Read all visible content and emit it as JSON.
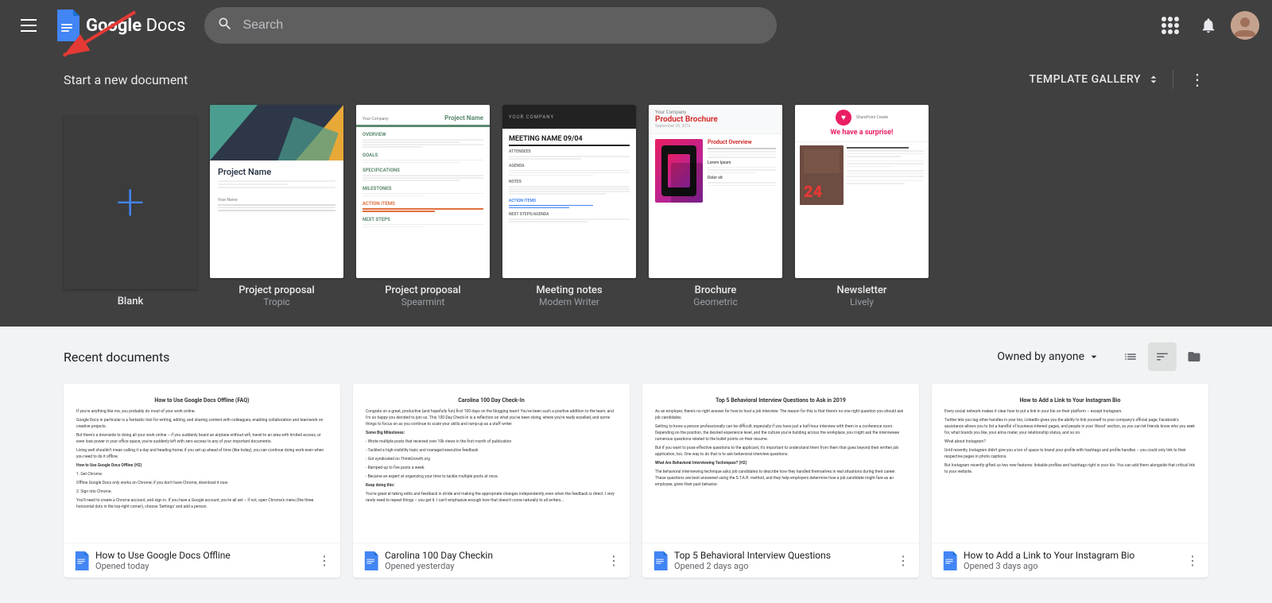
{
  "header": {
    "menu_label": "Main menu",
    "logo_text": "Google Docs",
    "logo_google": "Google",
    "logo_docs": "Docs",
    "search_placeholder": "Search",
    "apps_label": "Google apps",
    "notifications_label": "Notifications"
  },
  "template_section": {
    "title": "Start a new document",
    "gallery_label": "TEMPLATE GALLERY",
    "templates": [
      {
        "id": "blank",
        "name": "Blank",
        "sub": ""
      },
      {
        "id": "project-tropic",
        "name": "Project proposal",
        "sub": "Tropic"
      },
      {
        "id": "project-spearmint",
        "name": "Project proposal",
        "sub": "Spearmint"
      },
      {
        "id": "meeting-notes",
        "name": "Meeting notes",
        "sub": "Modern Writer"
      },
      {
        "id": "brochure",
        "name": "Brochure",
        "sub": "Geometric"
      },
      {
        "id": "newsletter",
        "name": "Newsletter",
        "sub": "Lively"
      }
    ]
  },
  "recent_section": {
    "title": "Recent documents",
    "owned_by_label": "Owned by anyone",
    "docs": [
      {
        "name": "How to Use Google Docs Offline",
        "date": "Opened today",
        "preview_title": "How to Use Google Docs Offline (FAQ)",
        "preview_lines": [
          "If you're anything like me, you probably do most of your work online.",
          "Google Docs in particular is a fantastic tool for writing, editing, and sharing content with colleagues, enabling collaboration and teamwork on creative projects.",
          "But there's a downside to doing all your work online – if you suddenly board an airplane without wifi, travel to an area with limited access, or even lose power in your office space, you're suddenly left with zero access to any of your important documents.",
          "Living well shouldn't mean calling it a day and heading home; if you set up ahead of time (like today), you can continue doing work even when you need to do it offline.",
          "How to Use Google Docs Offline (H2)",
          "1. Get Chrome.",
          "Offline Google Docs only works on Chrome; if you don't have Chrome, download it now.",
          "2. Sign into Chrome.",
          "You'll need to create a Chrome account, and sign in. If you have a Google account, you're all set – if not, open Chrome's menu (the three horizontal dots in the top-right corner), choose 'Settings' and add a person."
        ]
      },
      {
        "name": "Carolina 100 Day Checkin",
        "date": "Opened yesterday",
        "preview_title": "Carolina 100 Day Check-In",
        "preview_lines": [
          "Congrats on a great, productive (and hopefully fun) first 100 days on the blogging team! You've been such a positive addition to the team, and I'm so happy you decided to join us. This 100-Day Check-In is a reflection on what you've been doing, where you're really excelled, and some things to focus on as you continue to scale your skills and ramp-up as a staff writer.",
          "Some Big Milestones:",
          "Wrote multiple posts that received over 10k views in the first month of publication",
          "Tackled a high-visibility topic and managed executive feedback",
          "Got syndicated on ThinkGrowth.org",
          "Ramped-up to five posts a week",
          "Became an expert at organizing your time to tackle multiple posts at once.",
          "Keep doing this:",
          "You're great at taking edits and feedback in stride and making the appropriate changes independently, even when the feedback is direct. I very rarely need to repeat things..."
        ]
      },
      {
        "name": "Top 5 Behavioral Interview Questions",
        "date": "Opened 2 days ago",
        "preview_title": "Top 5 Behavioral Interview Questions to Ask in 2019",
        "preview_lines": [
          "As an employer, there's no right answer for how to host a job interview. The reason for this is that there's no one right question you should ask job candidates.",
          "Getting to know a person professionally can be difficult, especially if you have just a half-hour interview with them in a conference room. Depending on the position, the desired experience level, and the culture you're building across the workplace, you might ask the interviewee numerous questions related to the bullet points on their resume.",
          "But if you want to pose effective questions to the applicant, it's important to understand them from them that goes beyond their written job application, too. One way to do that is to ask behavioral interview questions.",
          "What Are Behavioral Interviewing Techniques? (H2)",
          "The behavioral interviewing technique asks job candidates to describe how they handled themselves in real situations during their career. These questions are best answered using the S.T.A.R. method, and they help employers determine how a job candidate might fare as an employee, given their past behavior."
        ]
      },
      {
        "name": "How to Add a Link to Your Instagram Bio",
        "date": "Opened 3 days ago",
        "preview_title": "How to Add a Link to Your Instagram Bio",
        "preview_lines": [
          "Every social network makes it clear how to put a link in your bio on their platform – except Instagram.",
          "Twitter lets you tag other handles in your bio; LinkedIn gives you the ability to link yourself to your company's official page; Facebook's assistance allows you to list a handful of business-interest pages, and people in your 'About' section, so you can let friends know who you seek for, what brands you like, your alma mater, your relationship status, and so on.",
          "What about Instagram?",
          "Until recently, Instagram didn't give you a ton of space to brand your profile with hashtags and profile handles – you could only link to their respective pages in photo captions.",
          "But Instagram recently gifted us two new features: linkable profiles and hashtags right in your bio. You can add them alongside that critical link to your website."
        ]
      }
    ]
  }
}
